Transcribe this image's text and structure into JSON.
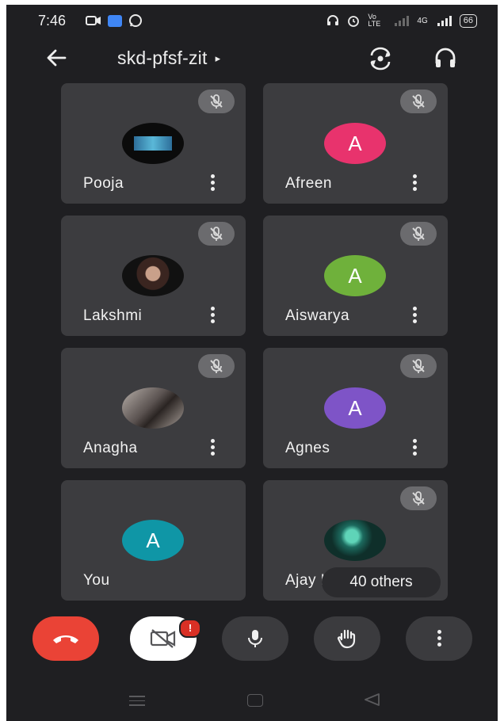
{
  "status_bar": {
    "time": "7:46",
    "right_text": "Vo LTE",
    "signal_text": "4G",
    "battery": "66"
  },
  "header": {
    "meeting_code": "skd-pfsf-zit",
    "caret": "▸"
  },
  "participants": [
    {
      "name": "Pooja",
      "avatar_type": "photo",
      "muted": true
    },
    {
      "name": "Afreen",
      "avatar_letter": "A",
      "avatar_color": "#e8336d",
      "muted": true
    },
    {
      "name": "Lakshmi",
      "avatar_type": "photo",
      "muted": true
    },
    {
      "name": "Aiswarya",
      "avatar_letter": "A",
      "avatar_color": "#6fb13b",
      "muted": true
    },
    {
      "name": "Anagha",
      "avatar_type": "photo",
      "muted": true
    },
    {
      "name": "Agnes",
      "avatar_letter": "A",
      "avatar_color": "#7e54c7",
      "muted": true
    },
    {
      "name": "You",
      "avatar_letter": "A",
      "avatar_color": "#0f96a6",
      "muted": false
    },
    {
      "name": "Ajay K",
      "avatar_type": "photo",
      "muted": true
    }
  ],
  "others_label": "40 others",
  "controls": {
    "camera_badge": "!"
  },
  "colors": {
    "background": "#1f1f22",
    "tile": "#3c3c3f",
    "end_call": "#ea4336",
    "badge": "#d93025"
  }
}
